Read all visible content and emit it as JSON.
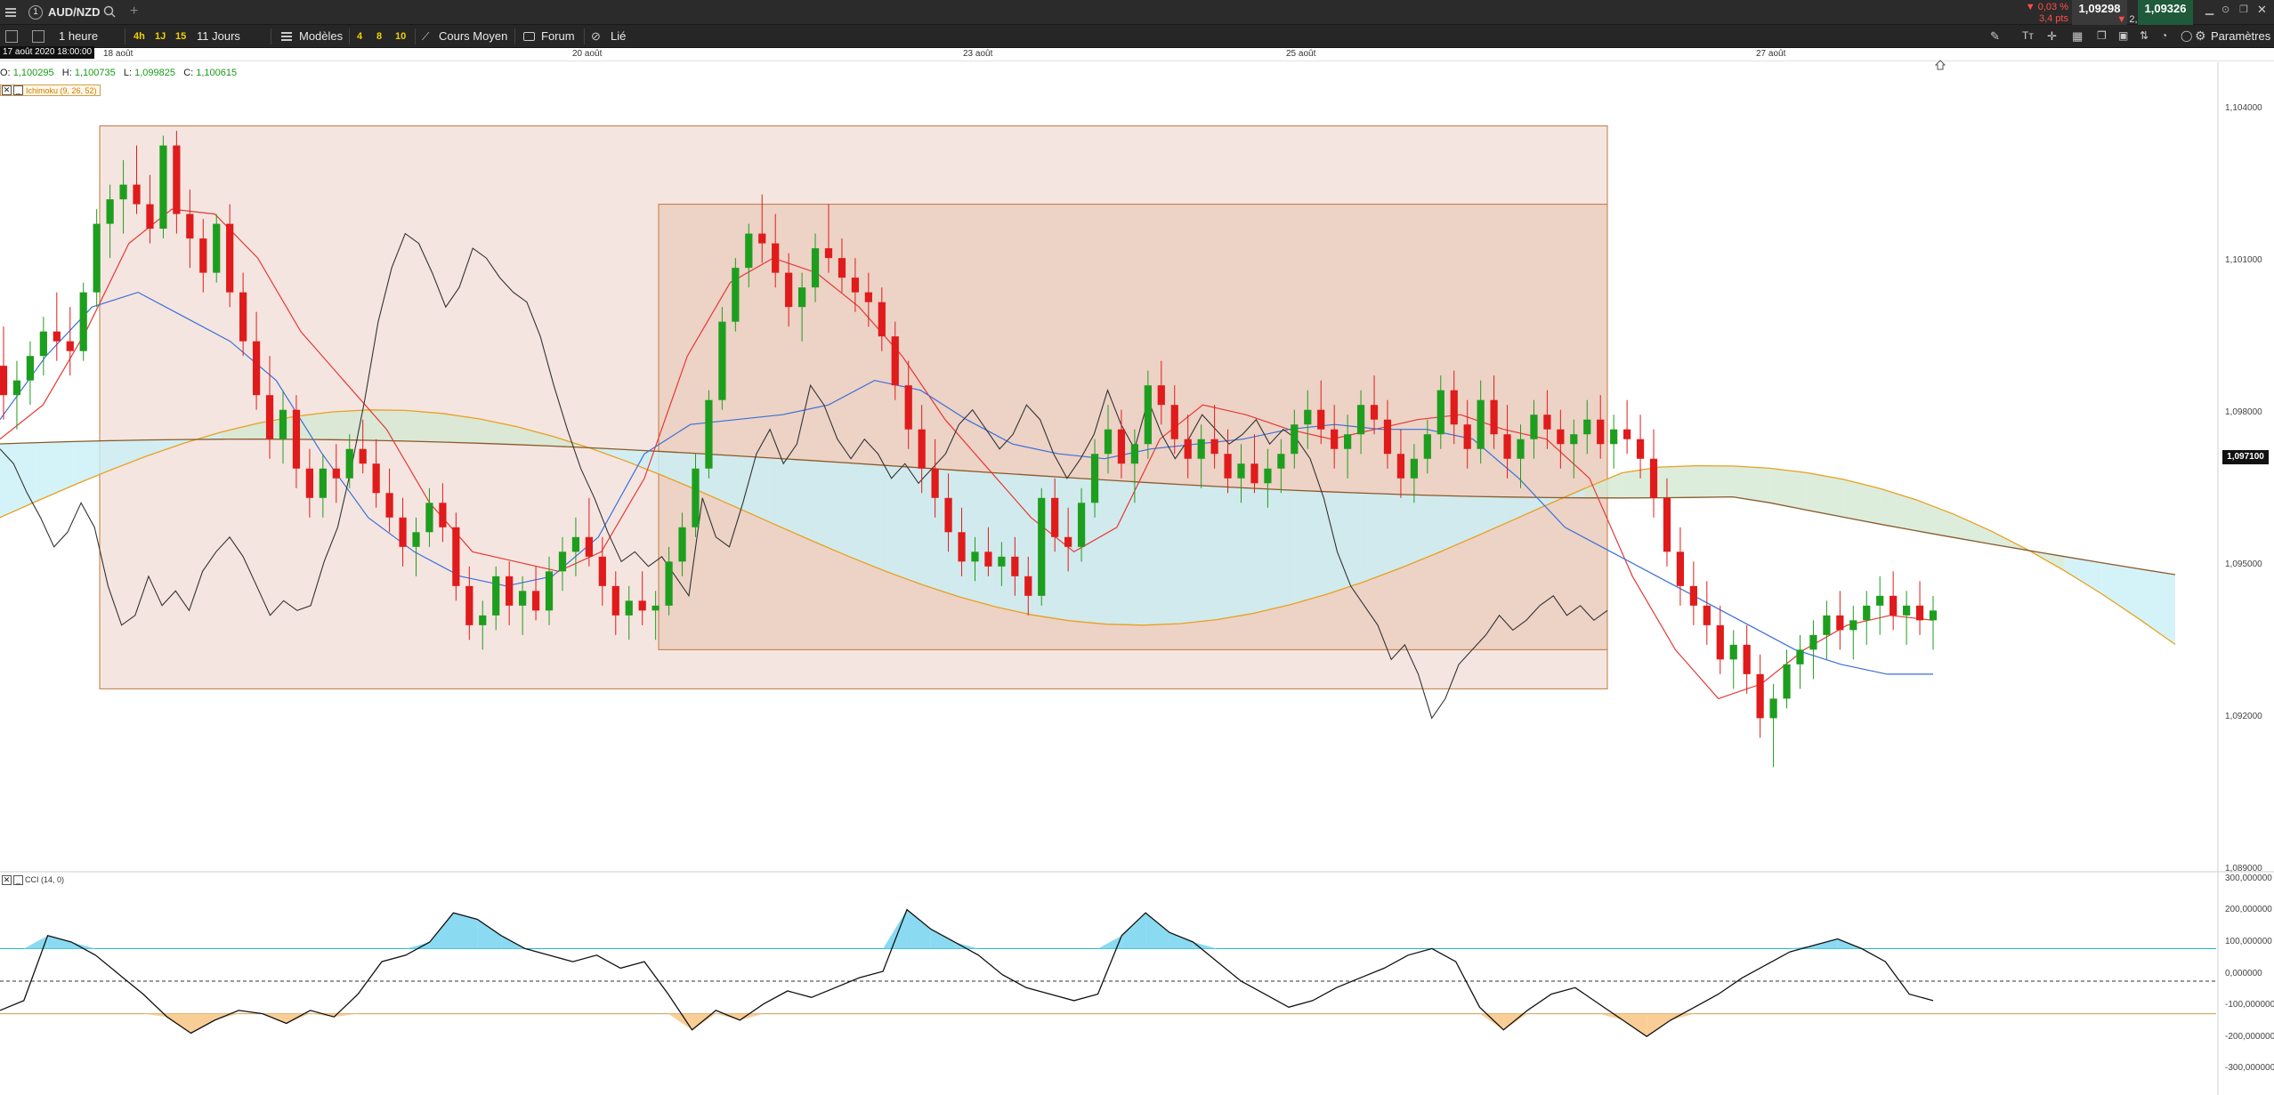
{
  "topbar": {
    "symbol": "AUD/NZD",
    "tab_number": "1",
    "change_pct": "▼ 0,03 %",
    "change_pips": "3,4 pts",
    "bid": "1,09298",
    "spread": "2,8",
    "ask": "1,09326"
  },
  "toolbar": {
    "timeframe": "1 heure",
    "quick_tf": [
      "4h",
      "1J",
      "15"
    ],
    "period": "11 Jours",
    "models": "Modèles",
    "nums": [
      "4",
      "8",
      "10"
    ],
    "avg_cost": "Cours Moyen",
    "forum": "Forum",
    "linked": "Lié",
    "settings": "Paramètres"
  },
  "time_axis": {
    "cursor": "17 août 2020 18:00:00",
    "labels": [
      "18 août",
      "20 août",
      "23 août",
      "25 août",
      "27 août"
    ]
  },
  "ohlc": {
    "o_label": "O:",
    "o": "1,100295",
    "h_label": "H:",
    "h": "1,100735",
    "l_label": "L:",
    "l": "1,099825",
    "c_label": "C:",
    "c": "1,100615"
  },
  "indicators": {
    "ichimoku": "Ichimoku (9, 26, 52)",
    "cci": "CCI (14, 0)"
  },
  "price_axis": {
    "labels": [
      "1,104000",
      "1,101000",
      "1,098000",
      "1,095000",
      "1,092000",
      "1,089000"
    ],
    "last_price": "1,097100"
  },
  "cci_axis": {
    "labels": [
      "300,000000",
      "200,000000",
      "100,000000",
      "0,000000",
      "-100,000000",
      "-200,000000",
      "-300,000000"
    ]
  },
  "colors": {
    "up": "#1e9e1e",
    "down": "#e01b1b",
    "tenkan": "#e53935",
    "kijun": "#3a6fd8",
    "span_a": "#e8a020",
    "span_b": "#8a5a2a",
    "chikou": "#333333",
    "box_outer": "#f3e1db",
    "box_inner": "#e9cbbd",
    "box_border": "#c0793d",
    "cloud_bull": "#d5e8d3",
    "cloud_bear": "#c9f0f6",
    "cci_line": "#111111",
    "cci_ob": "#7dd6f0",
    "cci_os": "#f7c98b",
    "cci_band": "#23b4c4"
  },
  "chart_data": {
    "type": "candlestick",
    "title": "",
    "instrument": "AUD/NZD",
    "timeframe": "1 heure",
    "ylim": [
      1.089,
      1.1055
    ],
    "x_dates": [
      "18 août",
      "20 août",
      "23 août",
      "25 août",
      "27 août"
    ],
    "candles": [
      [
        1.0993,
        1.1001,
        1.0982,
        1.0987
      ],
      [
        1.0987,
        1.0994,
        1.098,
        1.099
      ],
      [
        1.099,
        1.0998,
        1.0985,
        1.0995
      ],
      [
        1.0995,
        1.1003,
        1.0991,
        1.1
      ],
      [
        1.1,
        1.1008,
        1.0994,
        1.0998
      ],
      [
        1.0998,
        1.1005,
        1.0991,
        1.0996
      ],
      [
        1.0996,
        1.101,
        1.0994,
        1.1008
      ],
      [
        1.1008,
        1.1025,
        1.1005,
        1.1022
      ],
      [
        1.1022,
        1.103,
        1.1015,
        1.1027
      ],
      [
        1.1027,
        1.1035,
        1.102,
        1.103
      ],
      [
        1.103,
        1.1038,
        1.1024,
        1.1026
      ],
      [
        1.1026,
        1.1032,
        1.1018,
        1.1021
      ],
      [
        1.1021,
        1.104,
        1.1019,
        1.1038
      ],
      [
        1.1038,
        1.1041,
        1.102,
        1.1024
      ],
      [
        1.1024,
        1.1029,
        1.1013,
        1.1019
      ],
      [
        1.1019,
        1.1023,
        1.1008,
        1.1012
      ],
      [
        1.1012,
        1.1024,
        1.101,
        1.1022
      ],
      [
        1.1022,
        1.1026,
        1.1005,
        1.1008
      ],
      [
        1.1008,
        1.1012,
        1.0995,
        1.0998
      ],
      [
        1.0998,
        1.1004,
        1.0984,
        1.0987
      ],
      [
        1.0987,
        1.0995,
        1.0974,
        1.0978
      ],
      [
        1.0978,
        1.0988,
        1.0973,
        1.0984
      ],
      [
        1.0984,
        1.0987,
        1.0968,
        1.0972
      ],
      [
        1.0972,
        1.0976,
        1.0962,
        1.0966
      ],
      [
        1.0966,
        1.0975,
        1.0962,
        1.0972
      ],
      [
        1.0972,
        1.0977,
        1.0965,
        1.097
      ],
      [
        1.097,
        1.0979,
        1.0968,
        1.0976
      ],
      [
        1.0976,
        1.0982,
        1.0971,
        1.0973
      ],
      [
        1.0973,
        1.0978,
        1.0964,
        1.0967
      ],
      [
        1.0967,
        1.0972,
        1.0959,
        1.0962
      ],
      [
        1.0962,
        1.0966,
        1.0952,
        1.0956
      ],
      [
        1.0956,
        1.0962,
        1.095,
        1.0959
      ],
      [
        1.0959,
        1.0968,
        1.0956,
        1.0965
      ],
      [
        1.0965,
        1.0969,
        1.0957,
        1.096
      ],
      [
        1.096,
        1.0963,
        1.0945,
        1.0948
      ],
      [
        1.0948,
        1.0952,
        1.0937,
        1.094
      ],
      [
        1.094,
        1.0945,
        1.0935,
        1.0942
      ],
      [
        1.0942,
        1.0952,
        1.0939,
        1.095
      ],
      [
        1.095,
        1.0953,
        1.094,
        1.0944
      ],
      [
        1.0944,
        1.095,
        1.0938,
        1.0947
      ],
      [
        1.0947,
        1.0952,
        1.0941,
        1.0943
      ],
      [
        1.0943,
        1.0954,
        1.094,
        1.0951
      ],
      [
        1.0951,
        1.0958,
        1.0947,
        1.0955
      ],
      [
        1.0955,
        1.0962,
        1.095,
        1.0958
      ],
      [
        1.0958,
        1.0966,
        1.0952,
        1.0954
      ],
      [
        1.0954,
        1.0958,
        1.0944,
        1.0948
      ],
      [
        1.0948,
        1.0951,
        1.0938,
        1.0942
      ],
      [
        1.0942,
        1.0948,
        1.0937,
        1.0945
      ],
      [
        1.0945,
        1.0951,
        1.094,
        1.0943
      ],
      [
        1.0943,
        1.0947,
        1.0937,
        1.0944
      ],
      [
        1.0944,
        1.0956,
        1.0942,
        1.0953
      ],
      [
        1.0953,
        1.0963,
        1.095,
        1.096
      ],
      [
        1.096,
        1.0975,
        1.0958,
        1.0972
      ],
      [
        1.0972,
        1.0988,
        1.097,
        1.0986
      ],
      [
        1.0986,
        1.1005,
        1.0984,
        1.1002
      ],
      [
        1.1002,
        1.1015,
        1.1,
        1.1013
      ],
      [
        1.1013,
        1.1022,
        1.1009,
        1.102
      ],
      [
        1.102,
        1.1028,
        1.1014,
        1.1018
      ],
      [
        1.1018,
        1.1024,
        1.1009,
        1.1012
      ],
      [
        1.1012,
        1.1016,
        1.1001,
        1.1005
      ],
      [
        1.1005,
        1.1012,
        1.0998,
        1.1009
      ],
      [
        1.1009,
        1.102,
        1.1006,
        1.1017
      ],
      [
        1.1017,
        1.1026,
        1.1012,
        1.1015
      ],
      [
        1.1015,
        1.1019,
        1.1008,
        1.1011
      ],
      [
        1.1011,
        1.1015,
        1.1004,
        1.1008
      ],
      [
        1.1008,
        1.1012,
        1.1001,
        1.1006
      ],
      [
        1.1006,
        1.1009,
        1.0996,
        1.0999
      ],
      [
        1.0999,
        1.1002,
        1.0986,
        1.0989
      ],
      [
        1.0989,
        1.0994,
        1.0976,
        1.098
      ],
      [
        1.098,
        1.0985,
        1.0967,
        1.0972
      ],
      [
        1.0972,
        1.0978,
        1.0962,
        1.0966
      ],
      [
        1.0966,
        1.0971,
        1.0955,
        1.0959
      ],
      [
        1.0959,
        1.0964,
        1.095,
        1.0953
      ],
      [
        1.0953,
        1.0958,
        1.0949,
        1.0955
      ],
      [
        1.0955,
        1.096,
        1.095,
        1.0952
      ],
      [
        1.0952,
        1.0957,
        1.0948,
        1.0954
      ],
      [
        1.0954,
        1.0958,
        1.0946,
        1.095
      ],
      [
        1.095,
        1.0954,
        1.0942,
        1.0946
      ],
      [
        1.0946,
        1.0968,
        1.0944,
        1.0966
      ],
      [
        1.0966,
        1.097,
        1.0955,
        1.0958
      ],
      [
        1.0958,
        1.0964,
        1.0951,
        1.0956
      ],
      [
        1.0956,
        1.0968,
        1.0953,
        1.0965
      ],
      [
        1.0965,
        1.0978,
        1.0962,
        1.0975
      ],
      [
        1.0975,
        1.0985,
        1.0971,
        1.098
      ],
      [
        1.098,
        1.0984,
        1.097,
        1.0973
      ],
      [
        1.0973,
        1.098,
        1.0965,
        1.0977
      ],
      [
        1.0977,
        1.0992,
        1.0974,
        1.0989
      ],
      [
        1.0989,
        1.0994,
        1.0981,
        1.0985
      ],
      [
        1.0985,
        1.0989,
        1.0975,
        1.0978
      ],
      [
        1.0978,
        1.0983,
        1.097,
        1.0974
      ],
      [
        1.0974,
        1.0981,
        1.0968,
        1.0978
      ],
      [
        1.0978,
        1.0985,
        1.0972,
        1.0975
      ],
      [
        1.0975,
        1.098,
        1.0967,
        1.097
      ],
      [
        1.097,
        1.0977,
        1.0965,
        1.0973
      ],
      [
        1.0973,
        1.0979,
        1.0967,
        1.0969
      ],
      [
        1.0969,
        1.0976,
        1.0964,
        1.0972
      ],
      [
        1.0972,
        1.0978,
        1.0967,
        1.0975
      ],
      [
        1.0975,
        1.0984,
        1.0972,
        1.0981
      ],
      [
        1.0981,
        1.0988,
        1.0976,
        1.0984
      ],
      [
        1.0984,
        1.099,
        1.0977,
        1.098
      ],
      [
        1.098,
        1.0985,
        1.0972,
        1.0976
      ],
      [
        1.0976,
        1.0983,
        1.097,
        1.0979
      ],
      [
        1.0979,
        1.0988,
        1.0975,
        1.0985
      ],
      [
        1.0985,
        1.0991,
        1.0979,
        1.0982
      ],
      [
        1.0982,
        1.0986,
        1.0972,
        1.0975
      ],
      [
        1.0975,
        1.098,
        1.0966,
        1.097
      ],
      [
        1.097,
        1.0977,
        1.0965,
        1.0974
      ],
      [
        1.0974,
        1.0982,
        1.0971,
        1.0979
      ],
      [
        1.0979,
        1.0991,
        1.0976,
        1.0988
      ],
      [
        1.0988,
        1.0992,
        1.0977,
        1.0981
      ],
      [
        1.0981,
        1.0986,
        1.0972,
        1.0976
      ],
      [
        1.0976,
        1.099,
        1.0973,
        1.0986
      ],
      [
        1.0986,
        1.0991,
        1.0976,
        1.0979
      ],
      [
        1.0979,
        1.0985,
        1.097,
        1.0974
      ],
      [
        1.0974,
        1.0981,
        1.0968,
        1.0978
      ],
      [
        1.0978,
        1.0986,
        1.0974,
        1.0983
      ],
      [
        1.0983,
        1.0988,
        1.0976,
        1.098
      ],
      [
        1.098,
        1.0984,
        1.0972,
        1.0977
      ],
      [
        1.0977,
        1.0982,
        1.097,
        1.0979
      ],
      [
        1.0979,
        1.0986,
        1.0975,
        1.0982
      ],
      [
        1.0982,
        1.0987,
        1.0974,
        1.0977
      ],
      [
        1.0977,
        1.0983,
        1.0972,
        1.098
      ],
      [
        1.098,
        1.0986,
        1.0975,
        1.0978
      ],
      [
        1.0978,
        1.0983,
        1.097,
        1.0974
      ],
      [
        1.0974,
        1.098,
        1.0962,
        1.0966
      ],
      [
        1.0966,
        1.097,
        1.0952,
        1.0955
      ],
      [
        1.0955,
        1.096,
        1.0944,
        1.0948
      ],
      [
        1.0948,
        1.0953,
        1.094,
        1.0944
      ],
      [
        1.0944,
        1.0949,
        1.0936,
        1.094
      ],
      [
        1.094,
        1.0944,
        1.093,
        1.0933
      ],
      [
        1.0933,
        1.0939,
        1.0927,
        1.0936
      ],
      [
        1.0936,
        1.094,
        1.0926,
        1.093
      ],
      [
        1.093,
        1.0934,
        1.0917,
        1.0921
      ],
      [
        1.0921,
        1.0928,
        1.0911,
        1.0925
      ],
      [
        1.0925,
        1.0935,
        1.0923,
        1.0932
      ],
      [
        1.0932,
        1.0938,
        1.0927,
        1.0935
      ],
      [
        1.0935,
        1.0941,
        1.0929,
        1.0938
      ],
      [
        1.0938,
        1.0945,
        1.0933,
        1.0942
      ],
      [
        1.0942,
        1.0947,
        1.0935,
        1.0939
      ],
      [
        1.0939,
        1.0944,
        1.0933,
        1.0941
      ],
      [
        1.0941,
        1.0947,
        1.0936,
        1.0944
      ],
      [
        1.0944,
        1.095,
        1.0938,
        1.0946
      ],
      [
        1.0946,
        1.0951,
        1.0939,
        1.0942
      ],
      [
        1.0942,
        1.0947,
        1.0936,
        1.0944
      ],
      [
        1.0944,
        1.0949,
        1.0938,
        1.0941
      ],
      [
        1.0941,
        1.0946,
        1.0935,
        1.0943
      ]
    ],
    "tenkan": [
      1.0978,
      1.0985,
      1.1,
      1.1018,
      1.1025,
      1.1024,
      1.1015,
      1.1,
      1.099,
      1.098,
      1.0965,
      1.0955,
      1.0953,
      1.0951,
      1.0955,
      1.097,
      1.0995,
      1.101,
      1.1015,
      1.1012,
      1.1005,
      1.0995,
      1.0982,
      1.0972,
      1.0962,
      1.0955,
      1.096,
      1.0978,
      1.0985,
      1.0983,
      1.098,
      1.0978,
      1.098,
      1.0982,
      1.0983,
      1.098,
      1.0978,
      1.097,
      1.095,
      1.0935,
      1.0925,
      1.0928,
      1.0935,
      1.094,
      1.0942,
      1.0941
    ],
    "kijun": [
      1.0982,
      1.0995,
      1.1005,
      1.1008,
      1.1003,
      1.0998,
      1.099,
      1.0975,
      1.0962,
      1.0955,
      1.095,
      1.0948,
      1.095,
      1.0958,
      1.0975,
      1.0981,
      1.0982,
      1.0983,
      1.0985,
      1.099,
      1.0988,
      1.0982,
      1.0977,
      1.0975,
      1.0974,
      1.0976,
      1.0977,
      1.0978,
      1.098,
      1.0981,
      1.098,
      1.098,
      1.0978,
      1.097,
      1.096,
      1.0955,
      1.095,
      1.0945,
      1.094,
      1.0935,
      1.0932,
      1.093,
      1.093
    ],
    "cci": [
      -90,
      -60,
      140,
      120,
      80,
      20,
      -40,
      -110,
      -160,
      -120,
      -90,
      -100,
      -130,
      -90,
      -110,
      -40,
      60,
      80,
      120,
      210,
      190,
      140,
      100,
      80,
      60,
      80,
      40,
      60,
      -40,
      -150,
      -90,
      -120,
      -70,
      -30,
      -50,
      -20,
      10,
      30,
      220,
      160,
      120,
      80,
      20,
      -20,
      -40,
      -60,
      -40,
      140,
      210,
      150,
      120,
      60,
      0,
      -40,
      -80,
      -60,
      -20,
      10,
      40,
      80,
      100,
      60,
      -80,
      -150,
      -90,
      -40,
      -20,
      -70,
      -120,
      -170,
      -120,
      -80,
      -40,
      10,
      50,
      90,
      110,
      130,
      100,
      60,
      -40,
      -60
    ]
  }
}
